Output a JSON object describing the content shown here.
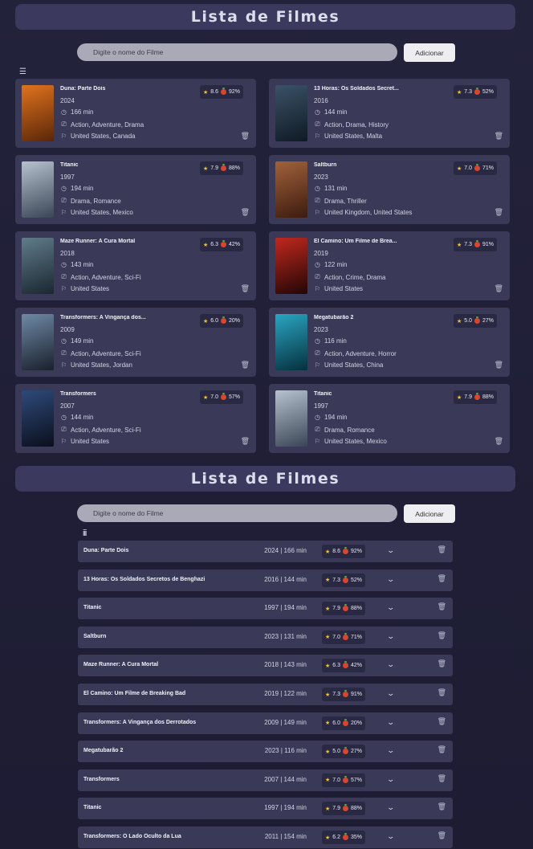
{
  "header": {
    "title": "Lista de Filmes"
  },
  "search": {
    "placeholder": "Digite o nome do Filme",
    "value": "",
    "button_label": "Adicionar"
  },
  "toggle_grid_glyph": "☰",
  "toggle_list_glyph": "iii",
  "colors": {
    "background": "#23223b",
    "card": "#3a3958",
    "title_bar": "#3b3a5e",
    "star": "#f0c23a",
    "tomato": "#d9462b"
  },
  "grid_movies": [
    {
      "title": "Duna: Parte Dois",
      "year": "2024",
      "runtime": "166 min",
      "genres": "Action, Adventure, Drama",
      "countries": "United States, Canada",
      "imdb": "8.6",
      "rt": "92%",
      "poster_colors": [
        "#e0731e",
        "#5a2608"
      ]
    },
    {
      "title": "13 Horas: Os Soldados Secret...",
      "year": "2016",
      "runtime": "144 min",
      "genres": "Action, Drama, History",
      "countries": "United States, Malta",
      "imdb": "7.3",
      "rt": "52%",
      "poster_colors": [
        "#3b5268",
        "#0f1a24"
      ]
    },
    {
      "title": "Titanic",
      "year": "1997",
      "runtime": "194 min",
      "genres": "Drama, Romance",
      "countries": "United States, Mexico",
      "imdb": "7.9",
      "rt": "88%",
      "poster_colors": [
        "#b7c2cf",
        "#3a4556"
      ]
    },
    {
      "title": "Saltburn",
      "year": "2023",
      "runtime": "131 min",
      "genres": "Drama, Thriller",
      "countries": "United Kingdom, United States",
      "imdb": "7.0",
      "rt": "71%",
      "poster_colors": [
        "#a0623a",
        "#3d1b10"
      ]
    },
    {
      "title": "Maze Runner: A Cura Mortal",
      "year": "2018",
      "runtime": "143 min",
      "genres": "Action, Adventure, Sci-Fi",
      "countries": "United States",
      "imdb": "6.3",
      "rt": "42%",
      "poster_colors": [
        "#607c8a",
        "#1a2730"
      ]
    },
    {
      "title": "El Camino: Um Filme de Brea...",
      "year": "2019",
      "runtime": "122 min",
      "genres": "Action, Crime, Drama",
      "countries": "United States",
      "imdb": "7.3",
      "rt": "91%",
      "poster_colors": [
        "#c0281e",
        "#220606"
      ]
    },
    {
      "title": "Transformers: A Vingança dos...",
      "year": "2009",
      "runtime": "149 min",
      "genres": "Action, Adventure, Sci-Fi",
      "countries": "United States, Jordan",
      "imdb": "6.0",
      "rt": "20%",
      "poster_colors": [
        "#6e8aa6",
        "#1a1f2c"
      ]
    },
    {
      "title": "Megatubarão 2",
      "year": "2023",
      "runtime": "116 min",
      "genres": "Action, Adventure, Horror",
      "countries": "United States, China",
      "imdb": "5.0",
      "rt": "27%",
      "poster_colors": [
        "#2aa6c2",
        "#06303e"
      ]
    },
    {
      "title": "Transformers",
      "year": "2007",
      "runtime": "144 min",
      "genres": "Action, Adventure, Sci-Fi",
      "countries": "United States",
      "imdb": "7.0",
      "rt": "57%",
      "poster_colors": [
        "#2e4a7a",
        "#0a0f1c"
      ]
    },
    {
      "title": "Titanic",
      "year": "1997",
      "runtime": "194 min",
      "genres": "Drama, Romance",
      "countries": "United States, Mexico",
      "imdb": "7.9",
      "rt": "88%",
      "poster_colors": [
        "#b7c2cf",
        "#3a4556"
      ]
    }
  ],
  "list_movies": [
    {
      "title": "Duna: Parte Dois",
      "meta": "2024 | 166 min",
      "imdb": "8.6",
      "rt": "92%"
    },
    {
      "title": "13 Horas: Os Soldados Secretos de Benghazi",
      "meta": "2016 | 144 min",
      "imdb": "7.3",
      "rt": "52%"
    },
    {
      "title": "Titanic",
      "meta": "1997 | 194 min",
      "imdb": "7.9",
      "rt": "88%"
    },
    {
      "title": "Saltburn",
      "meta": "2023 | 131 min",
      "imdb": "7.0",
      "rt": "71%"
    },
    {
      "title": "Maze Runner: A Cura Mortal",
      "meta": "2018 | 143 min",
      "imdb": "6.3",
      "rt": "42%"
    },
    {
      "title": "El Camino: Um Filme de Breaking Bad",
      "meta": "2019 | 122 min",
      "imdb": "7.3",
      "rt": "91%"
    },
    {
      "title": "Transformers: A Vingança dos Derrotados",
      "meta": "2009 | 149 min",
      "imdb": "6.0",
      "rt": "20%"
    },
    {
      "title": "Megatubarão 2",
      "meta": "2023 | 116 min",
      "imdb": "5.0",
      "rt": "27%"
    },
    {
      "title": "Transformers",
      "meta": "2007 | 144 min",
      "imdb": "7.0",
      "rt": "57%"
    },
    {
      "title": "Titanic",
      "meta": "1997 | 194 min",
      "imdb": "7.9",
      "rt": "88%"
    },
    {
      "title": "Transformers: O Lado Oculto da Lua",
      "meta": "2011 | 154 min",
      "imdb": "6.2",
      "rt": "35%"
    }
  ]
}
